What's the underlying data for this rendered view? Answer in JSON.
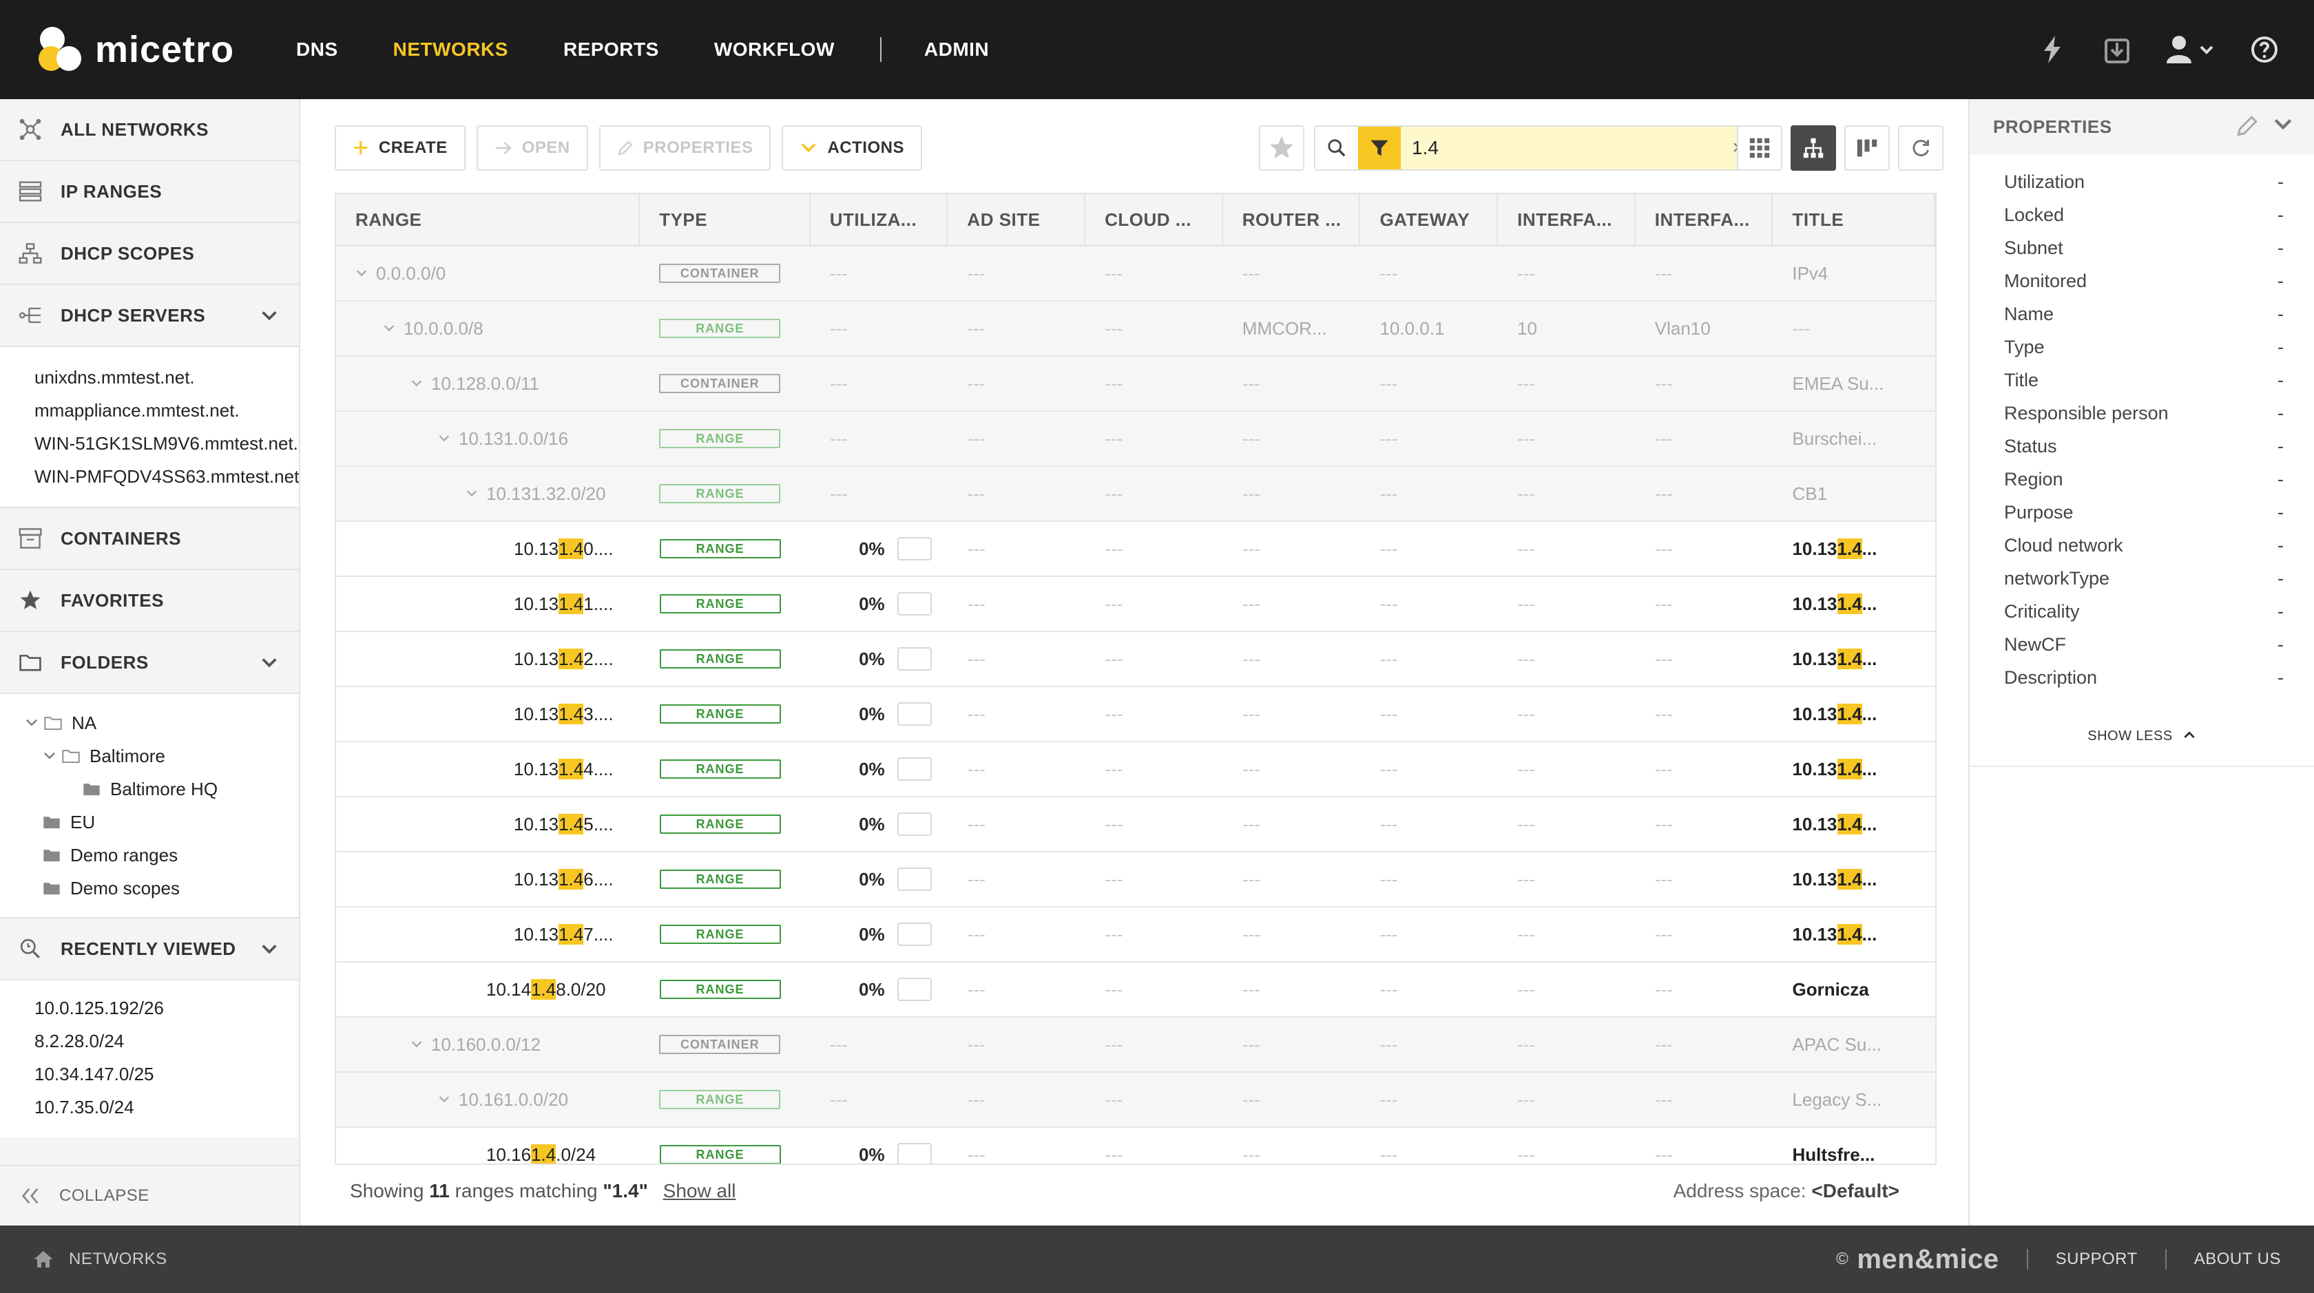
{
  "app": {
    "logo_text": "micetro"
  },
  "nav": {
    "items": [
      {
        "label": "DNS",
        "active": false
      },
      {
        "label": "NETWORKS",
        "active": true
      },
      {
        "label": "REPORTS",
        "active": false
      },
      {
        "label": "WORKFLOW",
        "active": false
      },
      {
        "label": "ADMIN",
        "active": false
      }
    ],
    "icons": [
      "lightning-icon",
      "inbox-icon",
      "user-icon",
      "help-icon"
    ]
  },
  "sidebar": {
    "sections": {
      "all_networks": "ALL NETWORKS",
      "ip_ranges": "IP RANGES",
      "dhcp_scopes": "DHCP SCOPES",
      "dhcp_servers": "DHCP SERVERS",
      "containers": "CONTAINERS",
      "favorites": "FAVORITES",
      "folders": "FOLDERS",
      "recently_viewed": "RECENTLY VIEWED"
    },
    "dhcp_servers": [
      "unixdns.mmtest.net.",
      "mmappliance.mmtest.net.",
      "WIN-51GK1SLM9V6.mmtest.net.",
      "WIN-PMFQDV4SS63.mmtest.net."
    ],
    "folders": [
      {
        "label": "NA"
      },
      {
        "label": "Baltimore"
      },
      {
        "label": "Baltimore HQ"
      },
      {
        "label": "EU"
      },
      {
        "label": "Demo ranges"
      },
      {
        "label": "Demo scopes"
      }
    ],
    "recently_viewed": [
      "10.0.125.192/26",
      "8.2.28.0/24",
      "10.34.147.0/25",
      "10.7.35.0/24"
    ],
    "collapse_label": "COLLAPSE"
  },
  "toolbar": {
    "create": "CREATE",
    "open": "OPEN",
    "properties": "PROPERTIES",
    "actions": "ACTIONS"
  },
  "search": {
    "value": "1.4",
    "placeholder": ""
  },
  "grid": {
    "columns": [
      "RANGE",
      "TYPE",
      "UTILIZA...",
      "AD SITE",
      "CLOUD ...",
      "ROUTER ...",
      "GATEWAY",
      "INTERFA...",
      "INTERFA...",
      "TITLE"
    ],
    "dash": "---",
    "rows": [
      {
        "pre": "0.0.0.0/0",
        "hl": "",
        "post": "",
        "type": "CONTAINER",
        "util": "",
        "router": "",
        "gateway": "",
        "if1": "",
        "if2": "",
        "t_pre": "IPv4",
        "t_hl": "",
        "t_post": ""
      },
      {
        "pre": "10.0.0.0/8",
        "hl": "",
        "post": "",
        "type": "RANGE",
        "util": "",
        "router": "MMCOR...",
        "gateway": "10.0.0.1",
        "if1": "10",
        "if2": "Vlan10",
        "t_pre": "---",
        "t_hl": "",
        "t_post": ""
      },
      {
        "pre": "10.128.0.0/11",
        "hl": "",
        "post": "",
        "type": "CONTAINER",
        "util": "",
        "router": "",
        "gateway": "",
        "if1": "",
        "if2": "",
        "t_pre": "EMEA Su...",
        "t_hl": "",
        "t_post": ""
      },
      {
        "pre": "10.131.0.0/16",
        "hl": "",
        "post": "",
        "type": "RANGE",
        "util": "",
        "router": "",
        "gateway": "",
        "if1": "",
        "if2": "",
        "t_pre": "Burschei...",
        "t_hl": "",
        "t_post": ""
      },
      {
        "pre": "10.131.32.0/20",
        "hl": "",
        "post": "",
        "type": "RANGE",
        "util": "",
        "router": "",
        "gateway": "",
        "if1": "",
        "if2": "",
        "t_pre": "CB1",
        "t_hl": "",
        "t_post": ""
      },
      {
        "pre": "10.13",
        "hl": "1.4",
        "post": "0....",
        "type": "RANGE",
        "util": "0%",
        "router": "",
        "gateway": "",
        "if1": "",
        "if2": "",
        "t_pre": "10.13",
        "t_hl": "1.4",
        "t_post": "..."
      },
      {
        "pre": "10.13",
        "hl": "1.4",
        "post": "1....",
        "type": "RANGE",
        "util": "0%",
        "router": "",
        "gateway": "",
        "if1": "",
        "if2": "",
        "t_pre": "10.13",
        "t_hl": "1.4",
        "t_post": "..."
      },
      {
        "pre": "10.13",
        "hl": "1.4",
        "post": "2....",
        "type": "RANGE",
        "util": "0%",
        "router": "",
        "gateway": "",
        "if1": "",
        "if2": "",
        "t_pre": "10.13",
        "t_hl": "1.4",
        "t_post": "..."
      },
      {
        "pre": "10.13",
        "hl": "1.4",
        "post": "3....",
        "type": "RANGE",
        "util": "0%",
        "router": "",
        "gateway": "",
        "if1": "",
        "if2": "",
        "t_pre": "10.13",
        "t_hl": "1.4",
        "t_post": "..."
      },
      {
        "pre": "10.13",
        "hl": "1.4",
        "post": "4....",
        "type": "RANGE",
        "util": "0%",
        "router": "",
        "gateway": "",
        "if1": "",
        "if2": "",
        "t_pre": "10.13",
        "t_hl": "1.4",
        "t_post": "..."
      },
      {
        "pre": "10.13",
        "hl": "1.4",
        "post": "5....",
        "type": "RANGE",
        "util": "0%",
        "router": "",
        "gateway": "",
        "if1": "",
        "if2": "",
        "t_pre": "10.13",
        "t_hl": "1.4",
        "t_post": "..."
      },
      {
        "pre": "10.13",
        "hl": "1.4",
        "post": "6....",
        "type": "RANGE",
        "util": "0%",
        "router": "",
        "gateway": "",
        "if1": "",
        "if2": "",
        "t_pre": "10.13",
        "t_hl": "1.4",
        "t_post": "..."
      },
      {
        "pre": "10.13",
        "hl": "1.4",
        "post": "7....",
        "type": "RANGE",
        "util": "0%",
        "router": "",
        "gateway": "",
        "if1": "",
        "if2": "",
        "t_pre": "10.13",
        "t_hl": "1.4",
        "t_post": "..."
      },
      {
        "pre": "10.14",
        "hl": "1.4",
        "post": "8.0/20",
        "type": "RANGE",
        "util": "0%",
        "router": "",
        "gateway": "",
        "if1": "",
        "if2": "",
        "t_pre": "Gornicza",
        "t_hl": "",
        "t_post": ""
      },
      {
        "pre": "10.160.0.0/12",
        "hl": "",
        "post": "",
        "type": "CONTAINER",
        "util": "",
        "router": "",
        "gateway": "",
        "if1": "",
        "if2": "",
        "t_pre": "APAC Su...",
        "t_hl": "",
        "t_post": ""
      },
      {
        "pre": "10.161.0.0/20",
        "hl": "",
        "post": "",
        "type": "RANGE",
        "util": "",
        "router": "",
        "gateway": "",
        "if1": "",
        "if2": "",
        "t_pre": "Legacy S...",
        "t_hl": "",
        "t_post": ""
      },
      {
        "pre": "10.16",
        "hl": "1.4",
        "post": ".0/24",
        "type": "RANGE",
        "util": "0%",
        "router": "",
        "gateway": "",
        "if1": "",
        "if2": "",
        "t_pre": "Hultsfre...",
        "t_hl": "",
        "t_post": ""
      }
    ]
  },
  "status": {
    "showing": "Showing",
    "count": "11",
    "matching": "ranges matching",
    "query": "\"1.4\"",
    "show_all": "Show all",
    "address_space_label": "Address space:",
    "address_space_value": "<Default>"
  },
  "properties": {
    "title": "PROPERTIES",
    "items": [
      {
        "label": "Utilization",
        "value": "-"
      },
      {
        "label": "Locked",
        "value": "-"
      },
      {
        "label": "Subnet",
        "value": "-"
      },
      {
        "label": "Monitored",
        "value": "-"
      },
      {
        "label": "Name",
        "value": "-"
      },
      {
        "label": "Type",
        "value": "-"
      },
      {
        "label": "Title",
        "value": "-"
      },
      {
        "label": "Responsible person",
        "value": "-"
      },
      {
        "label": "Status",
        "value": "-"
      },
      {
        "label": "Region",
        "value": "-"
      },
      {
        "label": "Purpose",
        "value": "-"
      },
      {
        "label": "Cloud network",
        "value": "-"
      },
      {
        "label": "networkType",
        "value": "-"
      },
      {
        "label": "Criticality",
        "value": "-"
      },
      {
        "label": "NewCF",
        "value": "-"
      },
      {
        "label": "Description",
        "value": "-"
      }
    ],
    "show_less": "SHOW LESS"
  },
  "footer": {
    "breadcrumb": "NETWORKS",
    "copyright": "©",
    "brand": "men&mice",
    "support": "SUPPORT",
    "about": "ABOUT US"
  },
  "colors": {
    "accent": "#f7c623",
    "topbar": "#1c1c1c",
    "range_green": "#3a9a3a"
  }
}
